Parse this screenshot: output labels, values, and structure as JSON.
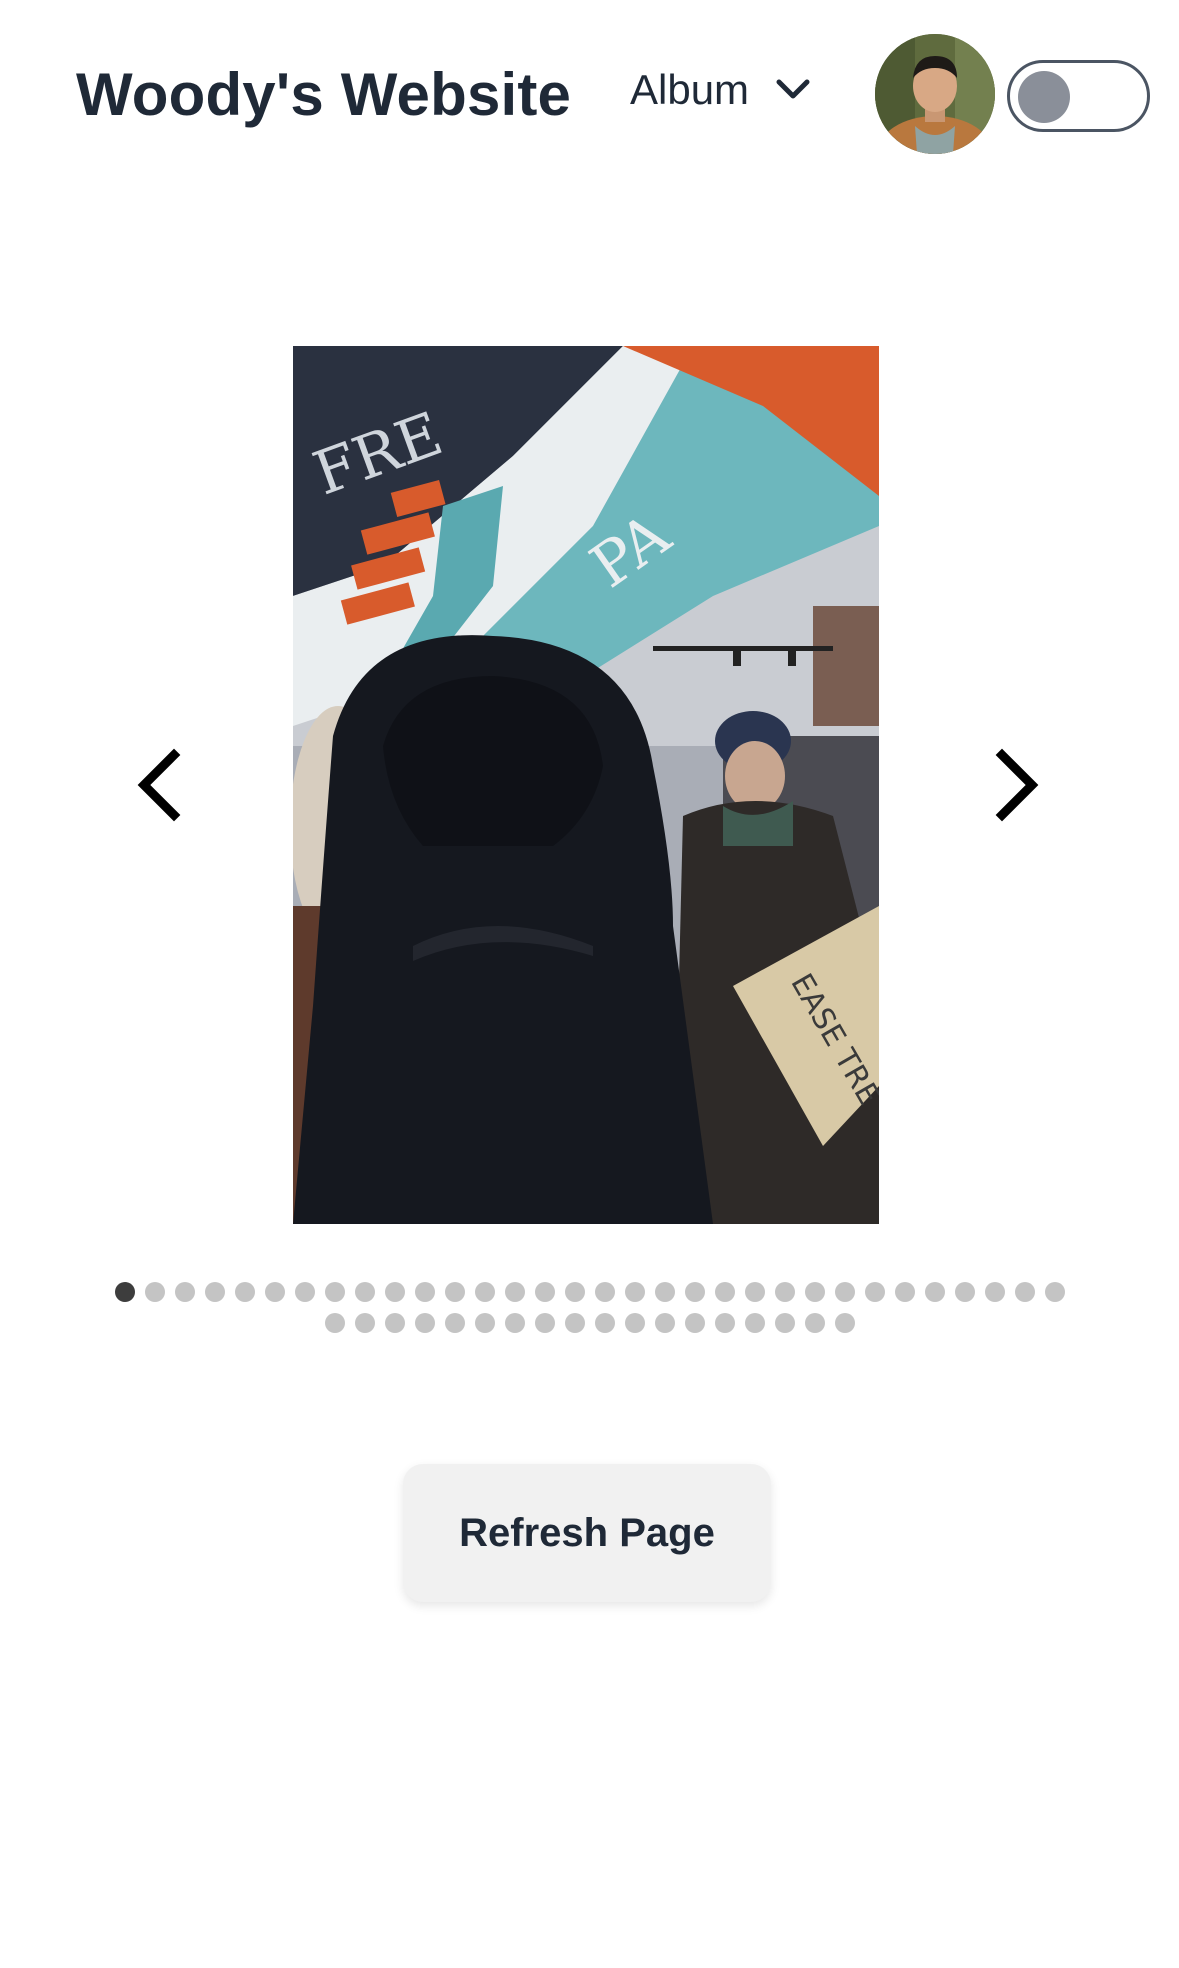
{
  "header": {
    "site_title": "Woody's Website",
    "album_label": "Album",
    "album_icon": "chevron-down-icon",
    "avatar_alt": "profile photo",
    "theme_toggle": {
      "state": "off"
    }
  },
  "carousel": {
    "image_alt": "Protester in hooded jacket beneath a waving flag",
    "flag_text_top": "FRE",
    "flag_text_mid": "PA",
    "sign_text": "EASE TRE",
    "prev_icon": "chevron-left-icon",
    "next_icon": "chevron-right-icon",
    "total_slides": 50,
    "active_index": 0
  },
  "actions": {
    "refresh_label": "Refresh Page"
  },
  "colors": {
    "text": "#1f2937",
    "dot_inactive": "#c4c4c4",
    "dot_active": "#3d3d3d",
    "button_bg": "#f1f1f1",
    "toggle_knob": "#8a8f99"
  }
}
